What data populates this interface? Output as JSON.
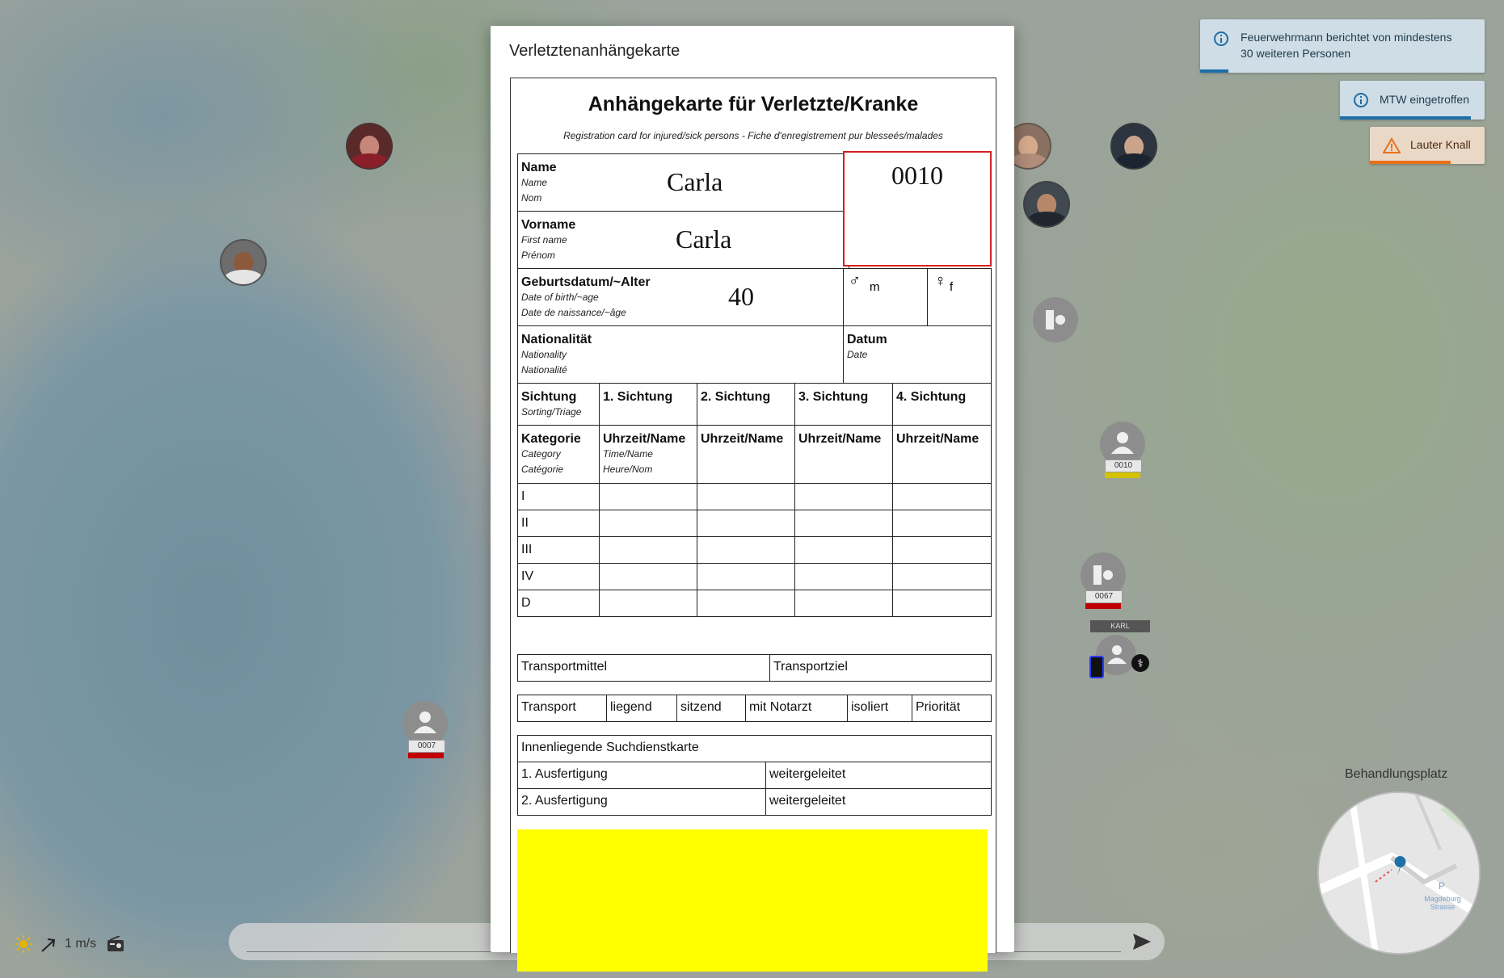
{
  "toasts": [
    {
      "text_line1": "Feuerwehrmann berichtet von mindestens",
      "text_line2": "30 weiteren Personen",
      "icon": "info-icon",
      "color": "#1f6fa8"
    },
    {
      "text": "MTW eingetroffen",
      "icon": "info-icon",
      "color": "#1f6fa8"
    },
    {
      "text": "Lauter Knall",
      "icon": "warning-icon",
      "color": "#e8701a"
    }
  ],
  "modal": {
    "title": "Verletztenanhängekarte",
    "card": {
      "title": "Anhängekarte für Verletzte/Kranke",
      "subtitle": "Registration card for injured/sick persons - Fiche d'enregistrement pur blesseés/malades",
      "name": {
        "label": "Name",
        "en": "Name",
        "fr": "Nom",
        "value": "Carla"
      },
      "firstname": {
        "label": "Vorname",
        "en": "First name",
        "fr": "Prénom",
        "value": "Carla"
      },
      "id_number": "0010",
      "birth": {
        "label": "Geburtsdatum/~Alter",
        "en": "Date of birth/~age",
        "fr": "Date de naissance/~âge",
        "value": "40"
      },
      "sex": {
        "male_symbol": "♂",
        "male": "m",
        "female_symbol": "♀",
        "female": "f"
      },
      "nationality": {
        "label": "Nationalität",
        "en": "Nationality",
        "fr": "Nationalité"
      },
      "date": {
        "label": "Datum",
        "en": "Date"
      },
      "triage": {
        "header": {
          "label": "Sichtung",
          "sub": "Sorting/Triage"
        },
        "columns": [
          "1. Sichtung",
          "2. Sichtung",
          "3. Sichtung",
          "4. Sichtung"
        ],
        "category": {
          "label": "Kategorie",
          "en": "Category",
          "fr": "Catégorie"
        },
        "time_label": "Uhrzeit/Name",
        "time_en": "Time/Name",
        "time_fr": "Heure/Nom",
        "rows": [
          "I",
          "II",
          "III",
          "IV",
          "D"
        ]
      },
      "transport_means": "Transportmittel",
      "transport_target": "Transportziel",
      "transport_row": [
        "Transport",
        "liegend",
        "sitzend",
        "mit Notarzt",
        "isoliert",
        "Priorität"
      ],
      "search_card": "Innenliegende Suchdienstkarte",
      "copy1": "1. Ausfertigung",
      "copy2": "2. Ausfertigung",
      "forwarded": "weitergeleitet",
      "triage_color": "#ffff00"
    }
  },
  "map": {
    "patients": [
      {
        "id": "0007",
        "color": "#c00000"
      },
      {
        "id": "0010",
        "color": "#d4c200"
      },
      {
        "id": "0067",
        "color": "#c00000"
      }
    ],
    "vehicle_label": "KARL",
    "minimap_title": "Behandlungsplatz",
    "minimap_text": "Magdeburg Strasse",
    "minimap_p": "P"
  },
  "hud": {
    "wind_speed": "1 m/s",
    "weather_icon": "sun-icon",
    "wind_icon": "arrow-icon",
    "radio_icon": "radio-icon"
  },
  "chat": {
    "send_icon": "send-icon"
  }
}
